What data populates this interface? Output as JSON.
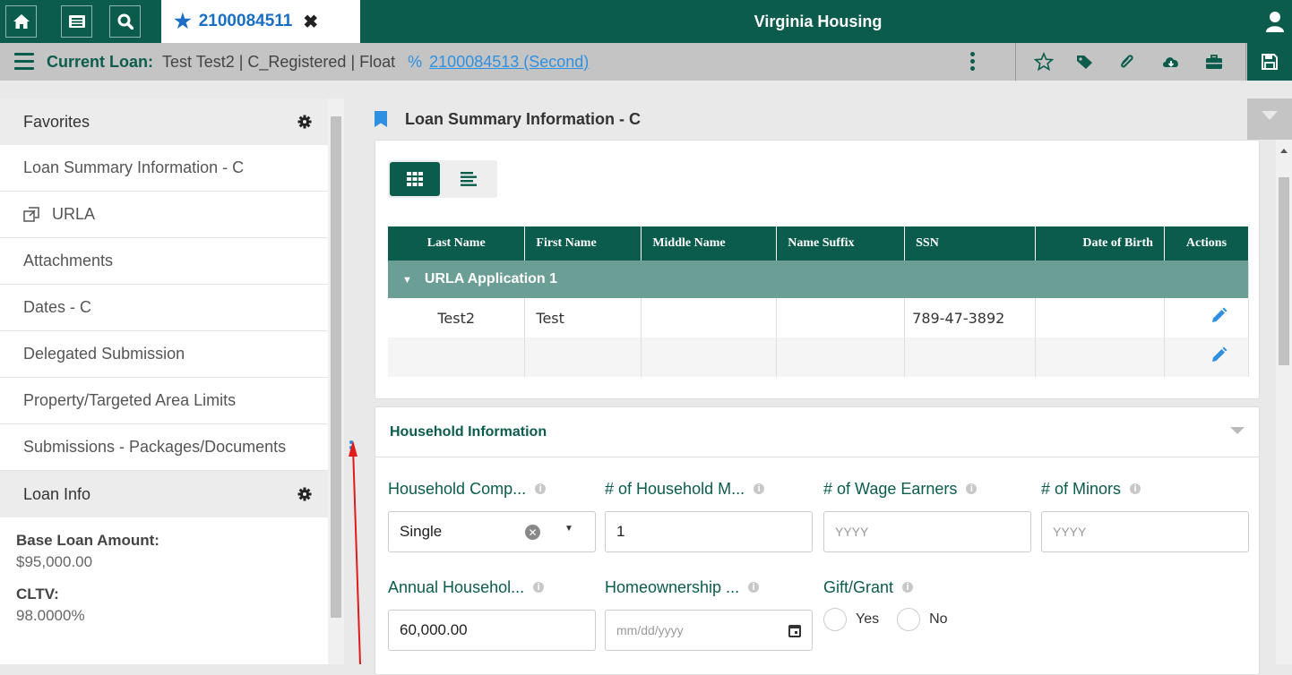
{
  "topbar": {
    "home_icon": "home-icon",
    "list_icon": "list-icon",
    "search_icon": "search-icon",
    "tab_label": "2100084511",
    "title": "Virginia Housing"
  },
  "subbar": {
    "current_loan_label": "Current Loan:",
    "current_loan_value": "Test Test2 | C_Registered | Float",
    "linked_loan": "2100084513 (Second)"
  },
  "sidebar": {
    "favorites_title": "Favorites",
    "items": [
      "Loan Summary Information - C",
      "URLA",
      "Attachments",
      "Dates - C",
      "Delegated Submission",
      "Property/Targeted Area Limits",
      "Submissions - Packages/Documents"
    ],
    "loan_info_title": "Loan Info",
    "base_loan_label": "Base Loan Amount:",
    "base_loan_value": "$95,000.00",
    "cltv_label": "CLTV:",
    "cltv_value": "98.0000%"
  },
  "main": {
    "section_title": "Loan Summary Information - C",
    "table": {
      "headers": [
        "Last Name",
        "First Name",
        "Middle Name",
        "Name Suffix",
        "SSN",
        "Date of Birth",
        "Actions"
      ],
      "group_label": "URLA Application 1",
      "rows": [
        [
          "Test2",
          "Test",
          "",
          "",
          "789-47-3892",
          ""
        ],
        [
          "",
          "",
          "",
          "",
          "",
          ""
        ]
      ]
    },
    "household": {
      "title": "Household Information",
      "composition_label": "Household Comp...",
      "composition_value": "Single",
      "members_label": "# of Household M...",
      "members_value": "1",
      "wage_earners_label": "# of Wage Earners",
      "wage_earners_placeholder": "YYYY",
      "minors_label": "# of Minors",
      "minors_placeholder": "YYYY",
      "income_label": "Annual Househol...",
      "income_value": "60,000.00",
      "homeownership_label": "Homeownership ...",
      "homeownership_placeholder": "mm/dd/yyyy",
      "gift_label": "Gift/Grant",
      "gift_yes": "Yes",
      "gift_no": "No"
    }
  },
  "colors": {
    "brand": "#0b5c4c",
    "link": "#2f8fe0",
    "group_row": "#6b9e94",
    "annotation_arrow": "#e01b1b"
  }
}
